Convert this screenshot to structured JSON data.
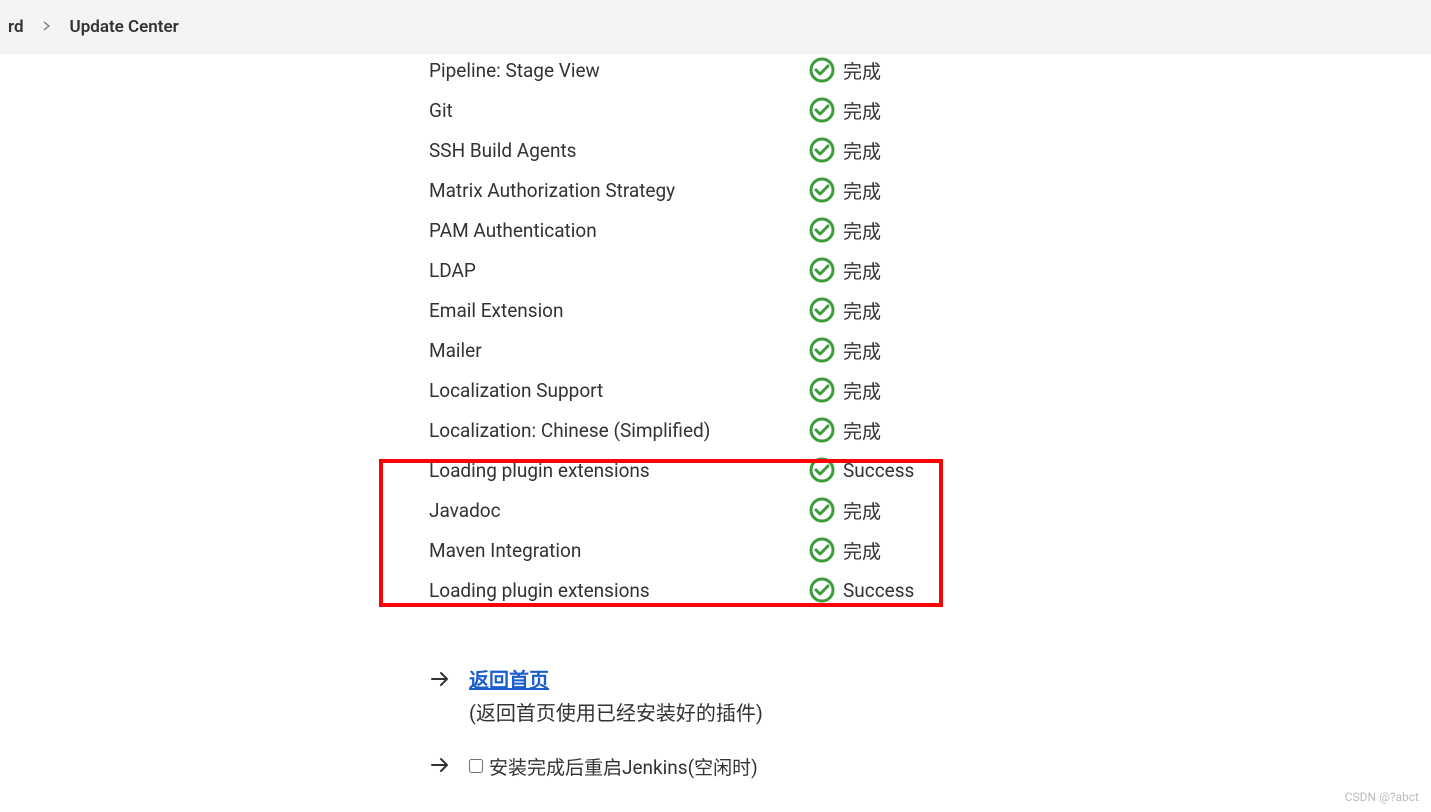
{
  "breadcrumb": {
    "item0_suffix": "rd",
    "item1": "Update Center"
  },
  "plugins": [
    {
      "name": "Pipeline: Stage View",
      "status": "完成"
    },
    {
      "name": "Git",
      "status": "完成"
    },
    {
      "name": "SSH Build Agents",
      "status": "完成"
    },
    {
      "name": "Matrix Authorization Strategy",
      "status": "完成"
    },
    {
      "name": "PAM Authentication",
      "status": "完成"
    },
    {
      "name": "LDAP",
      "status": "完成"
    },
    {
      "name": "Email Extension",
      "status": "完成"
    },
    {
      "name": "Mailer",
      "status": "完成"
    },
    {
      "name": "Localization Support",
      "status": "完成"
    },
    {
      "name": "Localization: Chinese (Simplified)",
      "status": "完成"
    },
    {
      "name": "Loading plugin extensions",
      "status": "Success"
    },
    {
      "name": "Javadoc",
      "status": "完成"
    },
    {
      "name": "Maven Integration",
      "status": "完成"
    },
    {
      "name": "Loading plugin extensions",
      "status": "Success"
    }
  ],
  "footer": {
    "return_link": "返回首页",
    "return_hint": "(返回首页使用已经安装好的插件)",
    "restart_label": "安装完成后重启Jenkins(空闲时)"
  },
  "watermark": "CSDN @?abct",
  "colors": {
    "success_green": "#3a9d3a",
    "link_blue": "#1a5dcc",
    "highlight_red": "#ff0000"
  }
}
